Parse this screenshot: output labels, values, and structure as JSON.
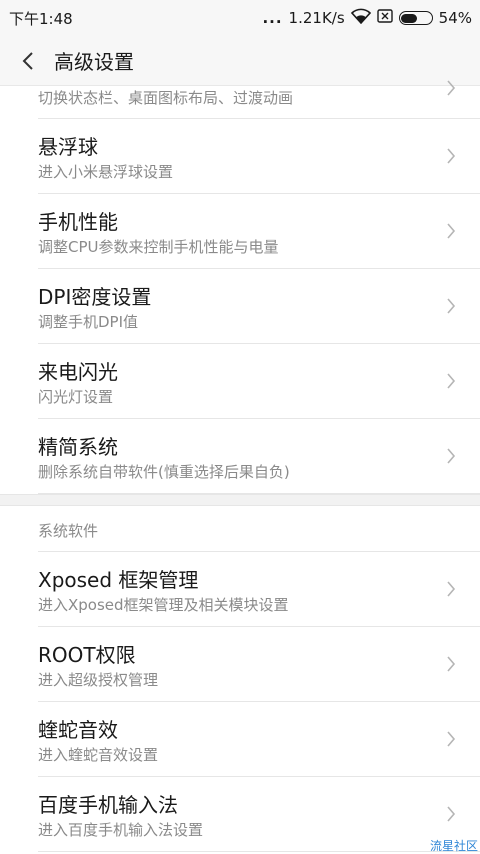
{
  "status_bar": {
    "time": "下午1:48",
    "dots": "...",
    "speed": "1.21K/s",
    "battery": "54%",
    "battery_level": 0.54
  },
  "header": {
    "title": "高级设置"
  },
  "partial_item": {
    "subtitle": "切换状态栏、桌面图标布局、过渡动画"
  },
  "items": [
    {
      "title": "悬浮球",
      "subtitle": "进入小米悬浮球设置"
    },
    {
      "title": "手机性能",
      "subtitle": "调整CPU参数来控制手机性能与电量"
    },
    {
      "title": "DPI密度设置",
      "subtitle": "调整手机DPI值"
    },
    {
      "title": "来电闪光",
      "subtitle": "闪光灯设置"
    },
    {
      "title": "精简系统",
      "subtitle": "删除系统自带软件(慎重选择后果自负)"
    }
  ],
  "section": {
    "title": "系统软件"
  },
  "items2": [
    {
      "title": "Xposed 框架管理",
      "subtitle": "进入Xposed框架管理及相关模块设置"
    },
    {
      "title": "ROOT权限",
      "subtitle": "进入超级授权管理"
    },
    {
      "title": "蝰蛇音效",
      "subtitle": "进入蝰蛇音效设置"
    },
    {
      "title": "百度手机输入法",
      "subtitle": "进入百度手机输入法设置"
    }
  ],
  "watermark": "流星社区"
}
